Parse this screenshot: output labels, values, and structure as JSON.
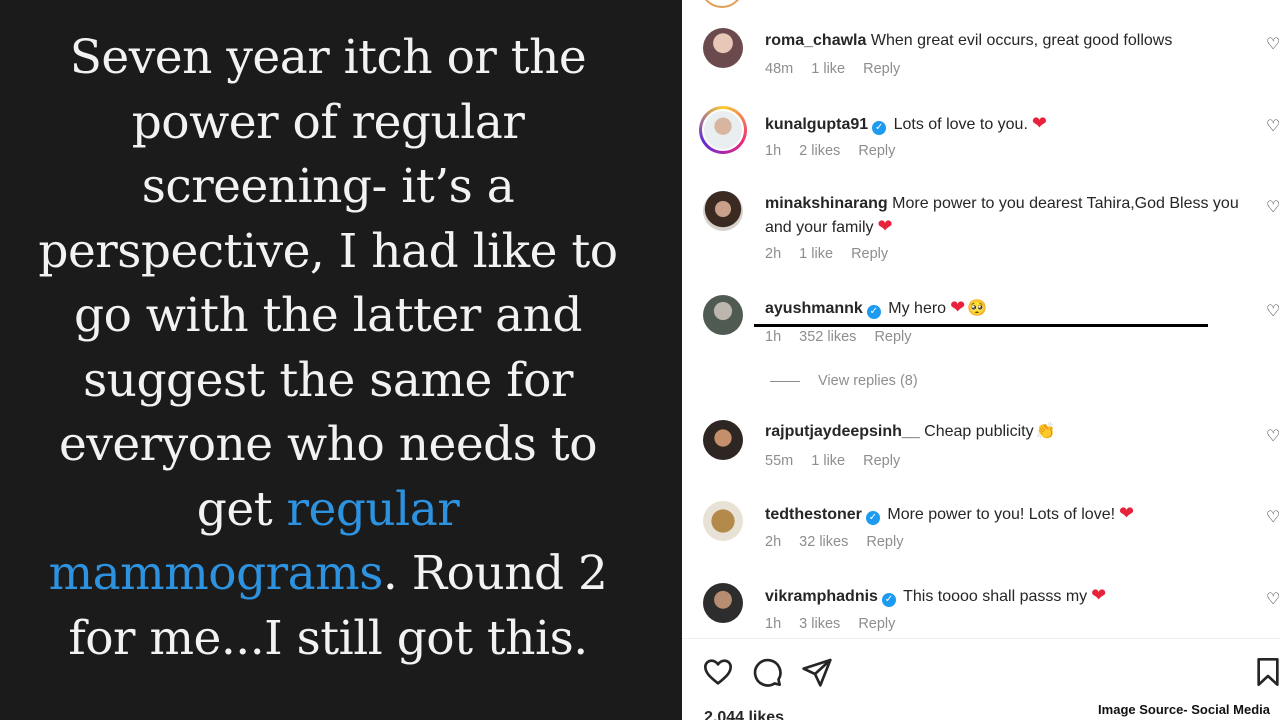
{
  "post": {
    "quote_before": "Seven year itch or the power of regular screening- it’s a perspective, I had like to go with the latter and suggest the same for everyone who needs to get ",
    "quote_highlight": "regular mammograms",
    "quote_after": ". Round 2 for me...I still got this."
  },
  "comments": [
    {
      "username": "roma_chawla",
      "verified": false,
      "text": "When great evil occurs, great good follows",
      "time": "48m",
      "likes": "1 like",
      "reply": "Reply"
    },
    {
      "username": "kunalgupta91",
      "verified": true,
      "text": "Lots of love to you.",
      "emoji": "heart",
      "time": "1h",
      "likes": "2 likes",
      "reply": "Reply"
    },
    {
      "username": "minakshinarang",
      "verified": false,
      "text": "More power to you dearest Tahira,God Bless you and your family",
      "emoji": "heart",
      "time": "2h",
      "likes": "1 like",
      "reply": "Reply"
    },
    {
      "username": "ayushmannk",
      "verified": true,
      "text": "My hero",
      "emoji": "heart+face",
      "time": "1h",
      "likes": "352 likes",
      "reply": "Reply"
    },
    {
      "username": "rajputjaydeepsinh__",
      "verified": false,
      "text": "Cheap publicity",
      "emoji": "clap",
      "time": "55m",
      "likes": "1 like",
      "reply": "Reply"
    },
    {
      "username": "tedthestoner",
      "verified": true,
      "text": "More power to you! Lots of love!",
      "emoji": "heart",
      "time": "2h",
      "likes": "32 likes",
      "reply": "Reply"
    },
    {
      "username": "vikramphadnis",
      "verified": true,
      "text": "This toooo shall passs my",
      "emoji": "heart",
      "time": "1h",
      "likes": "3 likes",
      "reply": "Reply"
    }
  ],
  "view_replies": "View replies (8)",
  "likes_count": "2,044 likes",
  "source_credit": "Image Source- Social Media",
  "icons": [
    "heart-icon",
    "comment-icon",
    "share-icon",
    "bookmark-icon"
  ],
  "colors": {
    "heart": "#e8223a",
    "verified": "#1d9bf0",
    "highlight": "#2d93e0"
  }
}
